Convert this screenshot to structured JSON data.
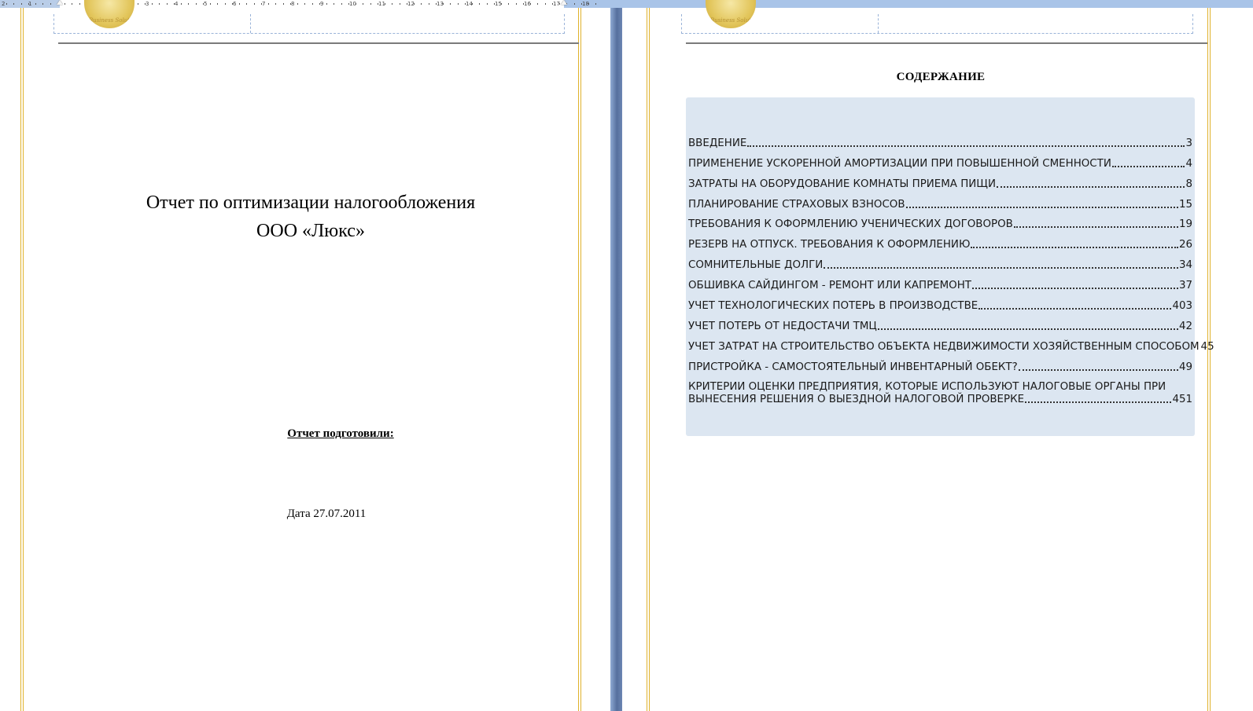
{
  "ruler": {
    "numbers": [
      "2",
      "1",
      "1",
      "2",
      "3",
      "4",
      "5",
      "6",
      "7",
      "8",
      "9",
      "10",
      "11",
      "12",
      "13",
      "14",
      "15",
      "16",
      "17",
      "18"
    ]
  },
  "left_page": {
    "seal_text": "Business Solut",
    "title_line1": "Отчет по оптимизации налогообложения",
    "title_line2": "ООО «Люкс»",
    "prepared_label": "Отчет подготовили:",
    "date_text": "Дата 27.07.2011"
  },
  "right_page": {
    "seal_text": "Business Solut",
    "toc_heading": "СОДЕРЖАНИЕ",
    "toc": [
      {
        "title": "ВВЕДЕНИЕ",
        "page": "3"
      },
      {
        "title": "ПРИМЕНЕНИЕ УСКОРЕННОЙ АМОРТИЗАЦИИ ПРИ ПОВЫШЕННОЙ СМЕННОСТИ ",
        "page": "4"
      },
      {
        "title": "ЗАТРАТЫ НА ОБОРУДОВАНИЕ КОМНАТЫ ПРИЕМА ПИЩИ ",
        "page": "8"
      },
      {
        "title": "ПЛАНИРОВАНИЕ СТРАХОВЫХ ВЗНОСОВ",
        "page": "15"
      },
      {
        "title": "ТРЕБОВАНИЯ К ОФОРМЛЕНИЮ УЧЕНИЧЕСКИХ ДОГОВОРОВ",
        "page": "19"
      },
      {
        "title": "РЕЗЕРВ НА ОТПУСК. ТРЕБОВАНИЯ К  ОФОРМЛЕНИЮ",
        "page": "26"
      },
      {
        "title": "СОМНИТЕЛЬНЫЕ ДОЛГИ",
        "page": "34"
      },
      {
        "title": "ОБШИВКА САЙДИНГОМ - РЕМОНТ ИЛИ КАПРЕМОНТ",
        "page": "37"
      },
      {
        "title": "УЧЕТ ТЕХНОЛОГИЧЕСКИХ ПОТЕРЬ В ПРОИЗВОДСТВЕ ",
        "page": " 403"
      },
      {
        "title": "УЧЕТ ПОТЕРЬ ОТ НЕДОСТАЧИ ТМЦ ",
        "page": "42"
      },
      {
        "title": "УЧЕТ ЗАТРАТ НА СТРОИТЕЛЬСТВО ОБЪЕКТА НЕДВИЖИМОСТИ ХОЗЯЙСТВЕННЫМ СПОСОБОМ",
        "page": "45"
      },
      {
        "title": "ПРИСТРОЙКА - САМОСТОЯТЕЛЬНЫЙ ИНВЕНТАРНЫЙ ОБЕКТ?",
        "page": "49"
      }
    ],
    "toc_last": {
      "line1": "КРИТЕРИИ ОЦЕНКИ ПРЕДПРИЯТИЯ, КОТОРЫЕ ИСПОЛЬЗУЮТ НАЛОГОВЫЕ ОРГАНЫ ПРИ",
      "line2": "ВЫНЕСЕНИЯ РЕШЕНИЯ О ВЫЕЗДНОЙ НАЛОГОВОЙ ПРОВЕРКЕ",
      "page": " 451"
    }
  },
  "colors": {
    "page_border_gold": "#e0b22c",
    "toc_background": "#dce6f1",
    "ruler_blue": "#a9c4e8",
    "gap_blue": "#56709e"
  }
}
